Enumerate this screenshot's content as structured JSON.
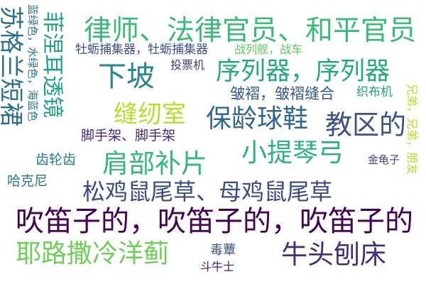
{
  "words": [
    {
      "text": "吹笛子的，吹笛子的，吹笛子的",
      "color": "#440154"
    },
    {
      "text": "律师、法律官员、和平官员",
      "color": "#3aba76"
    },
    {
      "text": "松鸡鼠尾草、母鸡鼠尾草",
      "color": "#3e4989"
    },
    {
      "text": "序列器，序列器",
      "color": "#23a883"
    },
    {
      "text": "保龄球鞋",
      "color": "#31668e"
    },
    {
      "text": "教区的",
      "color": "#3b528b"
    },
    {
      "text": "小提琴弓",
      "color": "#2bb07f"
    },
    {
      "text": "肩部补片",
      "color": "#35b779"
    },
    {
      "text": "耶路撒冷洋蓟",
      "color": "#6ece58"
    },
    {
      "text": "牛头刨床",
      "color": "#472c7a"
    },
    {
      "text": "下坡",
      "color": "#24868e"
    },
    {
      "text": "缝纫室",
      "color": "#b5de2b"
    },
    {
      "text": "苏格兰短裙",
      "color": "#2d708e"
    },
    {
      "text": "菲涅耳透镜",
      "color": "#1fa187"
    },
    {
      "text": "皱褶，皱褶缝合",
      "color": "#38588c"
    },
    {
      "text": "脚手架、脚手架",
      "color": "#482475"
    },
    {
      "text": "牡蛎捕集器，牡蛎捕集器",
      "color": "#3d4e8a"
    },
    {
      "text": "投票机",
      "color": "#443983"
    },
    {
      "text": "战列舰，战车",
      "color": "#5ec962"
    },
    {
      "text": "织布机",
      "color": "#1fa088"
    },
    {
      "text": "齿轮齿",
      "color": "#297b8e"
    },
    {
      "text": "哈克尼",
      "color": "#2a788e"
    },
    {
      "text": "金龟子",
      "color": "#3f4788"
    },
    {
      "text": "毒蕈",
      "color": "#3b528b"
    },
    {
      "text": "斗牛士",
      "color": "#481b6d"
    },
    {
      "text": "蓝绿色，水绿色，海蓝色",
      "color": "#2c728e"
    },
    {
      "text": "兄弟，兄弟，朋友",
      "color": "#b8de29"
    }
  ]
}
